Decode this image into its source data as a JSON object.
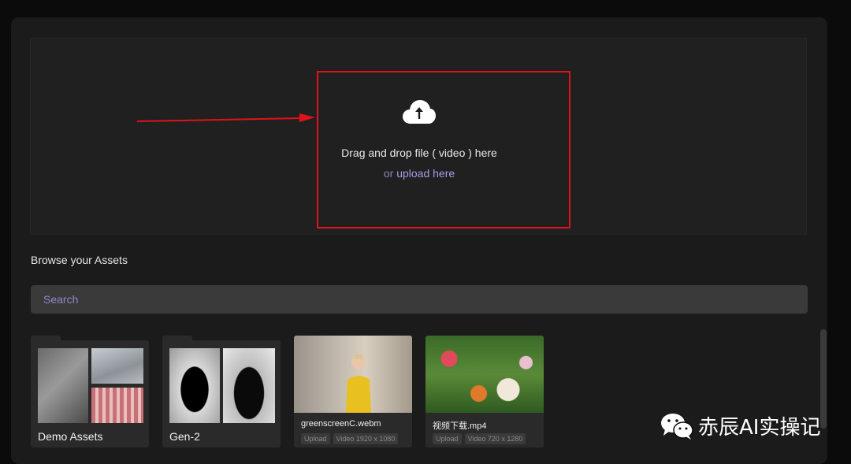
{
  "upload": {
    "icon": "cloud-upload-icon",
    "instruction": "Drag and drop file ( video ) here",
    "or_text": "or",
    "upload_link": "upload here"
  },
  "browse": {
    "title": "Browse your Assets",
    "search_placeholder": "Search"
  },
  "folders": [
    {
      "name": "Demo Assets",
      "icon": "folder-icon"
    },
    {
      "name": "Gen-2",
      "icon": "folder-icon"
    }
  ],
  "videos": [
    {
      "filename": "greenscreenC.webm",
      "badge": "Upload",
      "info": "Video 1920 x 1080"
    },
    {
      "filename": "视频下载.mp4",
      "badge": "Upload",
      "info": "Video 720 x 1280"
    }
  ],
  "annotation": {
    "color": "#e0121a"
  },
  "watermark": {
    "icon": "wechat-icon",
    "text": "赤辰AI实操记"
  },
  "colors": {
    "accent": "#a79be6",
    "panel": "#1b1b1b",
    "highlight": "#e0121a"
  }
}
